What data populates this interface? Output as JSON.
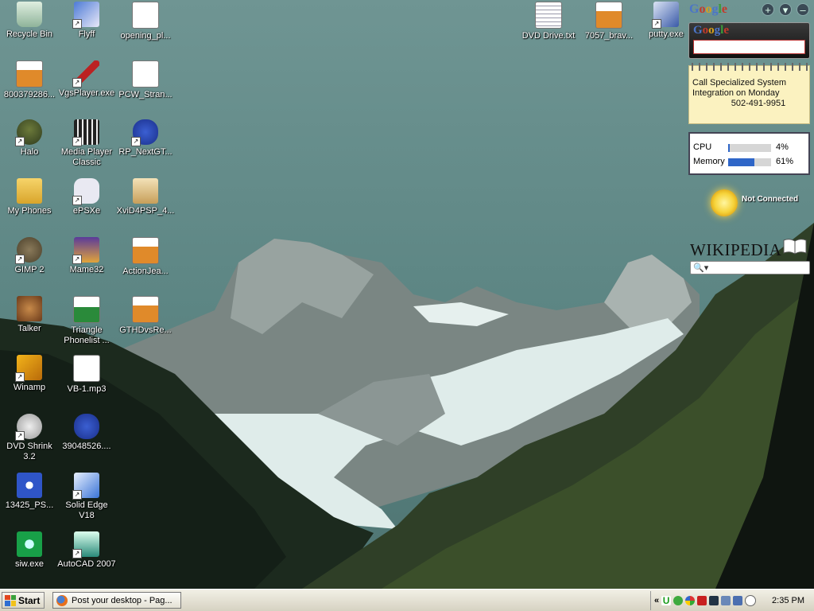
{
  "desktop": {
    "icons": [
      {
        "label": "Recycle Bin",
        "icon": "recycle-bin-icon"
      },
      {
        "label": "Flyff",
        "icon": "flyff-icon"
      },
      {
        "label": "opening_pl...",
        "icon": "document-icon"
      },
      {
        "label": "800379286...",
        "icon": "image-file-icon"
      },
      {
        "label": "VgsPlayer.exe",
        "icon": "guitar-icon"
      },
      {
        "label": "PCW_Stran...",
        "icon": "kmz-file-icon"
      },
      {
        "label": "Halo",
        "icon": "halo-icon"
      },
      {
        "label": "Media Player Classic",
        "icon": "media-player-icon"
      },
      {
        "label": "RP_NextGT...",
        "icon": "frog-icon"
      },
      {
        "label": "My Phones",
        "icon": "phone-folder-icon"
      },
      {
        "label": "ePSXe",
        "icon": "gamepad-icon"
      },
      {
        "label": "XviD4PSP_4...",
        "icon": "installer-icon"
      },
      {
        "label": "GIMP 2",
        "icon": "gimp-icon"
      },
      {
        "label": "Mame32",
        "icon": "mame-icon"
      },
      {
        "label": "ActionJea...",
        "icon": "image-file-icon"
      },
      {
        "label": "Talker",
        "icon": "talker-icon"
      },
      {
        "label": "Triangle Phonelist ...",
        "icon": "excel-file-icon"
      },
      {
        "label": "GTHDvsRe...",
        "icon": "image-file-icon"
      },
      {
        "label": "Winamp",
        "icon": "winamp-icon"
      },
      {
        "label": "VB-1.mp3",
        "icon": "mp3-file-icon"
      },
      {
        "label": "DVD Shrink 3.2",
        "icon": "dvd-shrink-icon"
      },
      {
        "label": "39048526....",
        "icon": "frog-icon"
      },
      {
        "label": "13425_PS...",
        "icon": "spiral-app-icon"
      },
      {
        "label": "Solid Edge V18",
        "icon": "solid-edge-icon"
      },
      {
        "label": "siw.exe",
        "icon": "siw-icon"
      },
      {
        "label": "AutoCAD 2007",
        "icon": "autocad-icon"
      },
      {
        "label": "DVD Drive.txt",
        "icon": "text-file-icon"
      },
      {
        "label": "7057_brav...",
        "icon": "image-file-icon"
      },
      {
        "label": "putty.exe",
        "icon": "putty-icon"
      }
    ]
  },
  "sidebar": {
    "google_label": "Google",
    "google_search_value": "",
    "notes": {
      "line1": "Call Specialized System",
      "line2": "Integration on Monday",
      "phone": "502-491-9951"
    },
    "cpu_meter": {
      "cpu_label": "CPU",
      "cpu_value": "4%",
      "cpu_fraction": 0.04,
      "memory_label": "Memory",
      "memory_value": "61%",
      "memory_fraction": 0.61
    },
    "weather_status": "Not Connected",
    "wikipedia": {
      "title": "Wikipedia",
      "search_value": ""
    }
  },
  "taskbar": {
    "start_label": "Start",
    "task_label": "Post your desktop - Pag...",
    "clock": "2:35 PM",
    "tray_chevron": "«"
  },
  "colors": {
    "xp_green": "#3a8f2e",
    "task_blue": "#2f66c8"
  }
}
